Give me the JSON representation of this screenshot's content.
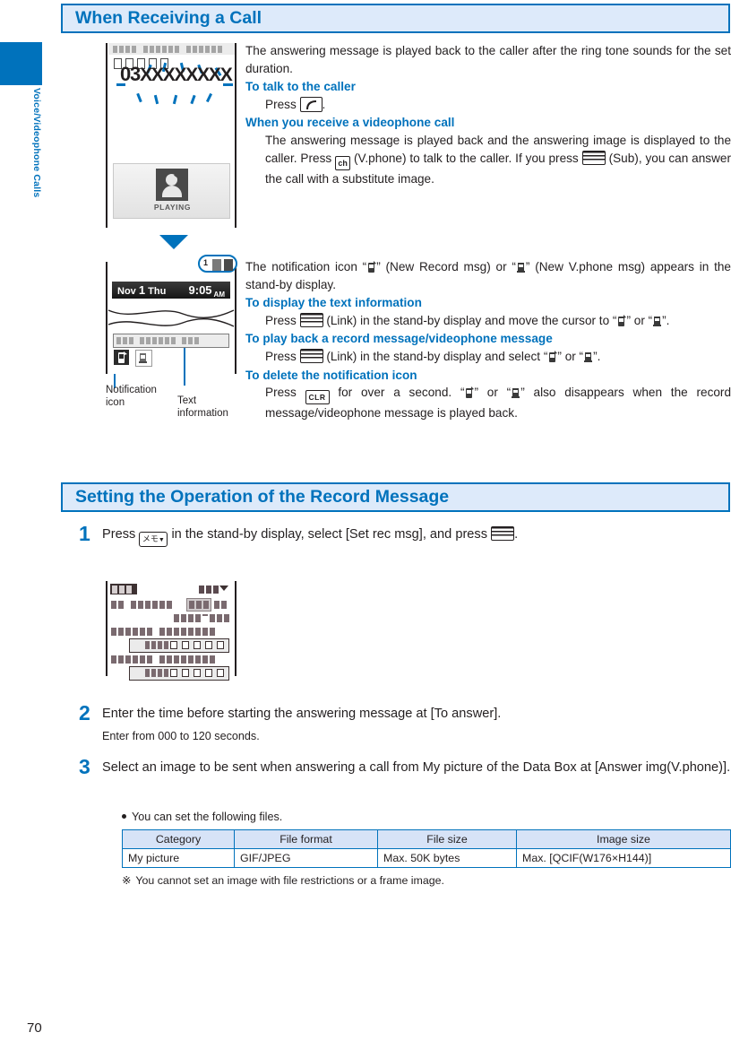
{
  "sidebar": {
    "chapter_label": "Voice/Videophone Calls",
    "accent": "#0072bc"
  },
  "page_number": "70",
  "sections": [
    {
      "id": "receiving",
      "title": "When Receiving a Call"
    },
    {
      "id": "setting",
      "title": "Setting the Operation of the Record Message"
    }
  ],
  "block1": {
    "intro": "The answering message is played back to the caller after the ring tone sounds for the set duration.",
    "sub1_head": "To talk to the caller",
    "sub1_press": "Press",
    "sub1_tail": ".",
    "sub2_head": "When you receive a videophone call",
    "sub2_a": "The answering message is played back and the answering image is displayed to the caller. Press",
    "sub2_b": "(V.phone) to talk to the caller. If you press",
    "sub2_c": "(Sub), you can answer the call with a substitute image."
  },
  "block2": {
    "intro_a": "The notification icon “",
    "intro_b": "” (New Record msg) or “",
    "intro_c": "” (New V.phone msg) appears in the stand-by display.",
    "sub1_head": "To display the text information",
    "sub1_a": "Press",
    "sub1_b": "(Link) in the stand-by display and move the cursor to “",
    "sub1_c": "” or “",
    "sub1_d": "”.",
    "sub2_head": "To play back a record message/videophone message",
    "sub2_a": "Press",
    "sub2_b": "(Link) in the stand-by display and select “",
    "sub2_c": "” or “",
    "sub2_d": "”.",
    "sub3_head": "To delete the notification icon",
    "sub3_a": "Press",
    "sub3_b": "for over a second. “",
    "sub3_c": "” or “",
    "sub3_d": "” also disappears when the record message/videophone message is played back."
  },
  "display1": {
    "caller_prefix": "03",
    "caller_number": "XXXXXXXX",
    "play_label": "PLAYING"
  },
  "display2": {
    "date_month": "Nov",
    "date_day": "1",
    "date_weekday": "Thu",
    "time": "9:05",
    "time_meridiem": "AM",
    "badge_count": "1",
    "callout_notification": "Notification icon",
    "callout_text": "Text information"
  },
  "steps": [
    {
      "num": "1",
      "text_a": "Press",
      "text_b": "in the stand-by display, select [Set rec msg], and press",
      "text_c": ".",
      "key_memo": "メモ",
      "key_memo_arrow": "▼"
    },
    {
      "num": "2",
      "text": "Enter the time before starting the answering message at [To answer].",
      "sub": "Enter from 000 to 120 seconds."
    },
    {
      "num": "3",
      "text": "Select an image to be sent when answering a call from My picture of the Data Box at [Answer img(V.phone)]."
    }
  ],
  "keys": {
    "call_key": "call-key",
    "ch_key": "ch",
    "clr_key": "CLR",
    "sub_key": "sub-link-key"
  },
  "bullet_note": "You can set the following files.",
  "spec_table": {
    "headers": [
      "Category",
      "File format",
      "File size",
      "Image size"
    ],
    "rows": [
      [
        "My picture",
        "GIF/JPEG",
        "Max. 50K bytes",
        "Max. [QCIF(W176×H144)]"
      ]
    ]
  },
  "footnote": {
    "marker": "※",
    "text": "You cannot set an image with file restrictions or a frame image."
  }
}
